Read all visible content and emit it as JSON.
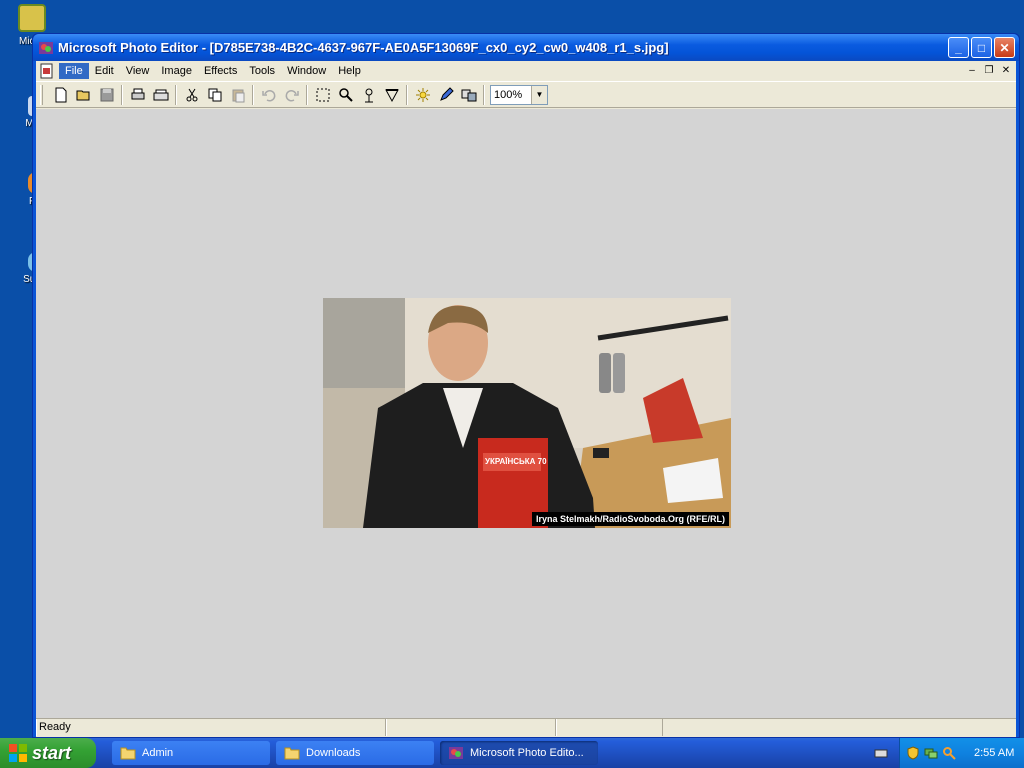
{
  "window": {
    "title": "Microsoft Photo Editor - [D785E738-4B2C-4637-967F-AE0A5F13069F_cx0_cy2_cw0_w408_r1_s.jpg]"
  },
  "desktop_icons": [
    {
      "label": "Mic O"
    },
    {
      "label": "My"
    },
    {
      "label": "F"
    },
    {
      "label": "Sup"
    }
  ],
  "menu": {
    "items": [
      "File",
      "Edit",
      "View",
      "Image",
      "Effects",
      "Tools",
      "Window",
      "Help"
    ]
  },
  "toolbar": {
    "zoom_value": "100%",
    "icons": [
      "new-icon",
      "open-icon",
      "save-icon",
      "print-icon",
      "scan-icon",
      "cut-icon",
      "copy-icon",
      "paste-icon",
      "undo-icon",
      "redo-icon",
      "select-icon",
      "zoom-icon",
      "smudge-icon",
      "fill-icon",
      "sun-icon",
      "pen-icon",
      "clone-icon"
    ]
  },
  "photo": {
    "caption": "Iryna Stelmakh/RadioSvoboda.Org (RFE/RL)",
    "book_title": "УКРАЇНСЬКА 70"
  },
  "status": {
    "text": "Ready"
  },
  "taskbar": {
    "start_label": "start",
    "tasks": [
      {
        "label": "Admin"
      },
      {
        "label": "Downloads"
      },
      {
        "label": "Microsoft Photo Edito..."
      }
    ],
    "clock": "2:55 AM"
  },
  "colors": {
    "desktop": "#0a4fa8",
    "titlebar": "#0a5be0",
    "workspace": "#d4d4d4",
    "menu_highlight": "#316ac5"
  }
}
